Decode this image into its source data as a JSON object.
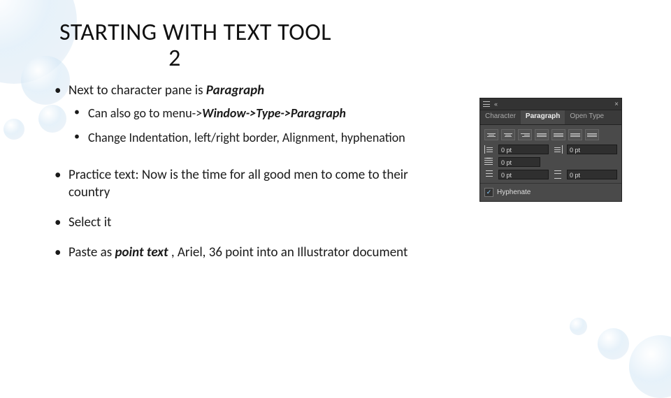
{
  "title_line1": "STARTING WITH TEXT TOOL",
  "title_line2": "2",
  "bullets": {
    "b1_pre": "Next to character pane is ",
    "b1_em": "Paragraph",
    "b1a_pre": "Can also go to menu->",
    "b1a_em": "Window->Type->Paragraph",
    "b1b": "Change Indentation, left/right border, Alignment, hyphenation",
    "b2": "Practice text: Now is the time for all good men to come to their country",
    "b3": "Select it",
    "b4_pre": "Paste as ",
    "b4_em": "point text",
    "b4_post": " , Ariel, 36 point into an Illustrator document"
  },
  "panel": {
    "tabs": {
      "character": "Character",
      "paragraph": "Paragraph",
      "opentype": "Open Type"
    },
    "indent_left": "0 pt",
    "indent_right": "0 pt",
    "first_line": "0 pt",
    "space_before": "0 pt",
    "space_after": "0 pt",
    "hyphenate": "Hyphenate",
    "close": "×",
    "collapse": "«"
  }
}
